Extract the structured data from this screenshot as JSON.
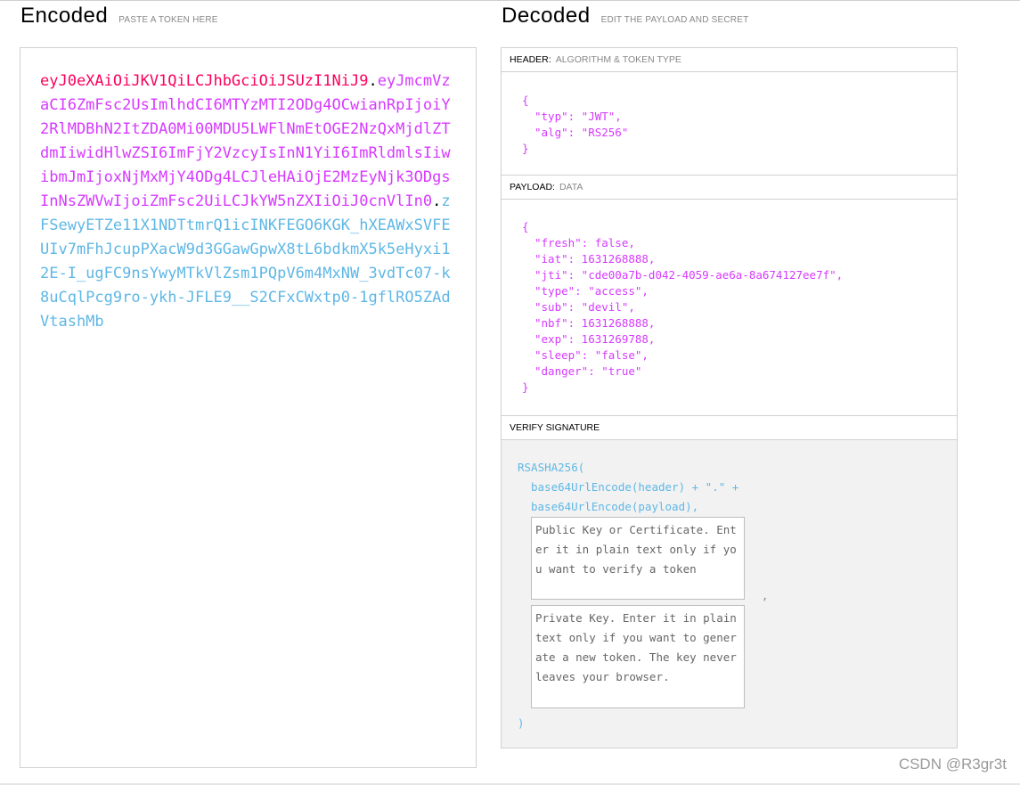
{
  "encoded": {
    "title": "Encoded",
    "subtitle": "PASTE A TOKEN HERE",
    "token_header": "eyJ0eXAiOiJKV1QiLCJhbGciOiJSUzI1NiJ9",
    "token_payload": "eyJmcmVzaCI6ZmFsc2UsImlhdCI6MTYzMTI2ODg4OCwianRpIjoiY2RlMDBhN2ItZDA0Mi00MDU5LWFlNmEtOGE2NzQxMjdlZTdmIiwidHlwZSI6ImFjY2VzcyIsInN1YiI6ImRldmlsIiwibmJmIjoxNjMxMjY4ODg4LCJleHAiOjE2MzEyNjk3ODgsInNsZWVwIjoiZmFsc2UiLCJkYW5nZXIiOiJ0cnVlIn0",
    "token_signature": "zFSewyETZe11X1NDTtmrQ1icINKFEGO6KGK_hXEAWxSVFEUIv7mFhJcupPXacW9d3GGawGpwX8tL6bdkmX5k5eHyxi12E-I_ugFC9nsYwyMTkVlZsm1PQpV6m4MxNW_3vdTc07-k8uCqlPcg9ro-ykh-JFLE9__S2CFxCWxtp0-1gflRO5ZAdVtashMb",
    "dot": "."
  },
  "decoded": {
    "title": "Decoded",
    "subtitle": "EDIT THE PAYLOAD AND SECRET",
    "header_section": {
      "label": "HEADER:",
      "sublabel": "ALGORITHM & TOKEN TYPE",
      "open": "{",
      "close": "}",
      "lines": [
        "\"typ\": \"JWT\",",
        "\"alg\": \"RS256\""
      ]
    },
    "payload_section": {
      "label": "PAYLOAD:",
      "sublabel": "DATA",
      "open": "{",
      "close": "}",
      "lines": [
        "\"fresh\": false,",
        "\"iat\": 1631268888,",
        "\"jti\": \"cde00a7b-d042-4059-ae6a-8a674127ee7f\",",
        "\"type\": \"access\",",
        "\"sub\": \"devil\",",
        "\"nbf\": 1631268888,",
        "\"exp\": 1631269788,",
        "\"sleep\": \"false\",",
        "\"danger\": \"true\""
      ]
    },
    "verify_section": {
      "label": "VERIFY SIGNATURE",
      "line1": "RSASHA256(",
      "line2": "base64UrlEncode(header) + \".\" +",
      "line3": "base64UrlEncode(payload),",
      "public_key_placeholder": "Public Key or Certificate. Enter it in plain text only if you want to verify a token",
      "comma": ",",
      "private_key_placeholder": "Private Key. Enter it in plain text only if you want to generate a new token. The key never leaves your browser.",
      "close": ")"
    }
  },
  "watermark": "CSDN @R3gr3t"
}
